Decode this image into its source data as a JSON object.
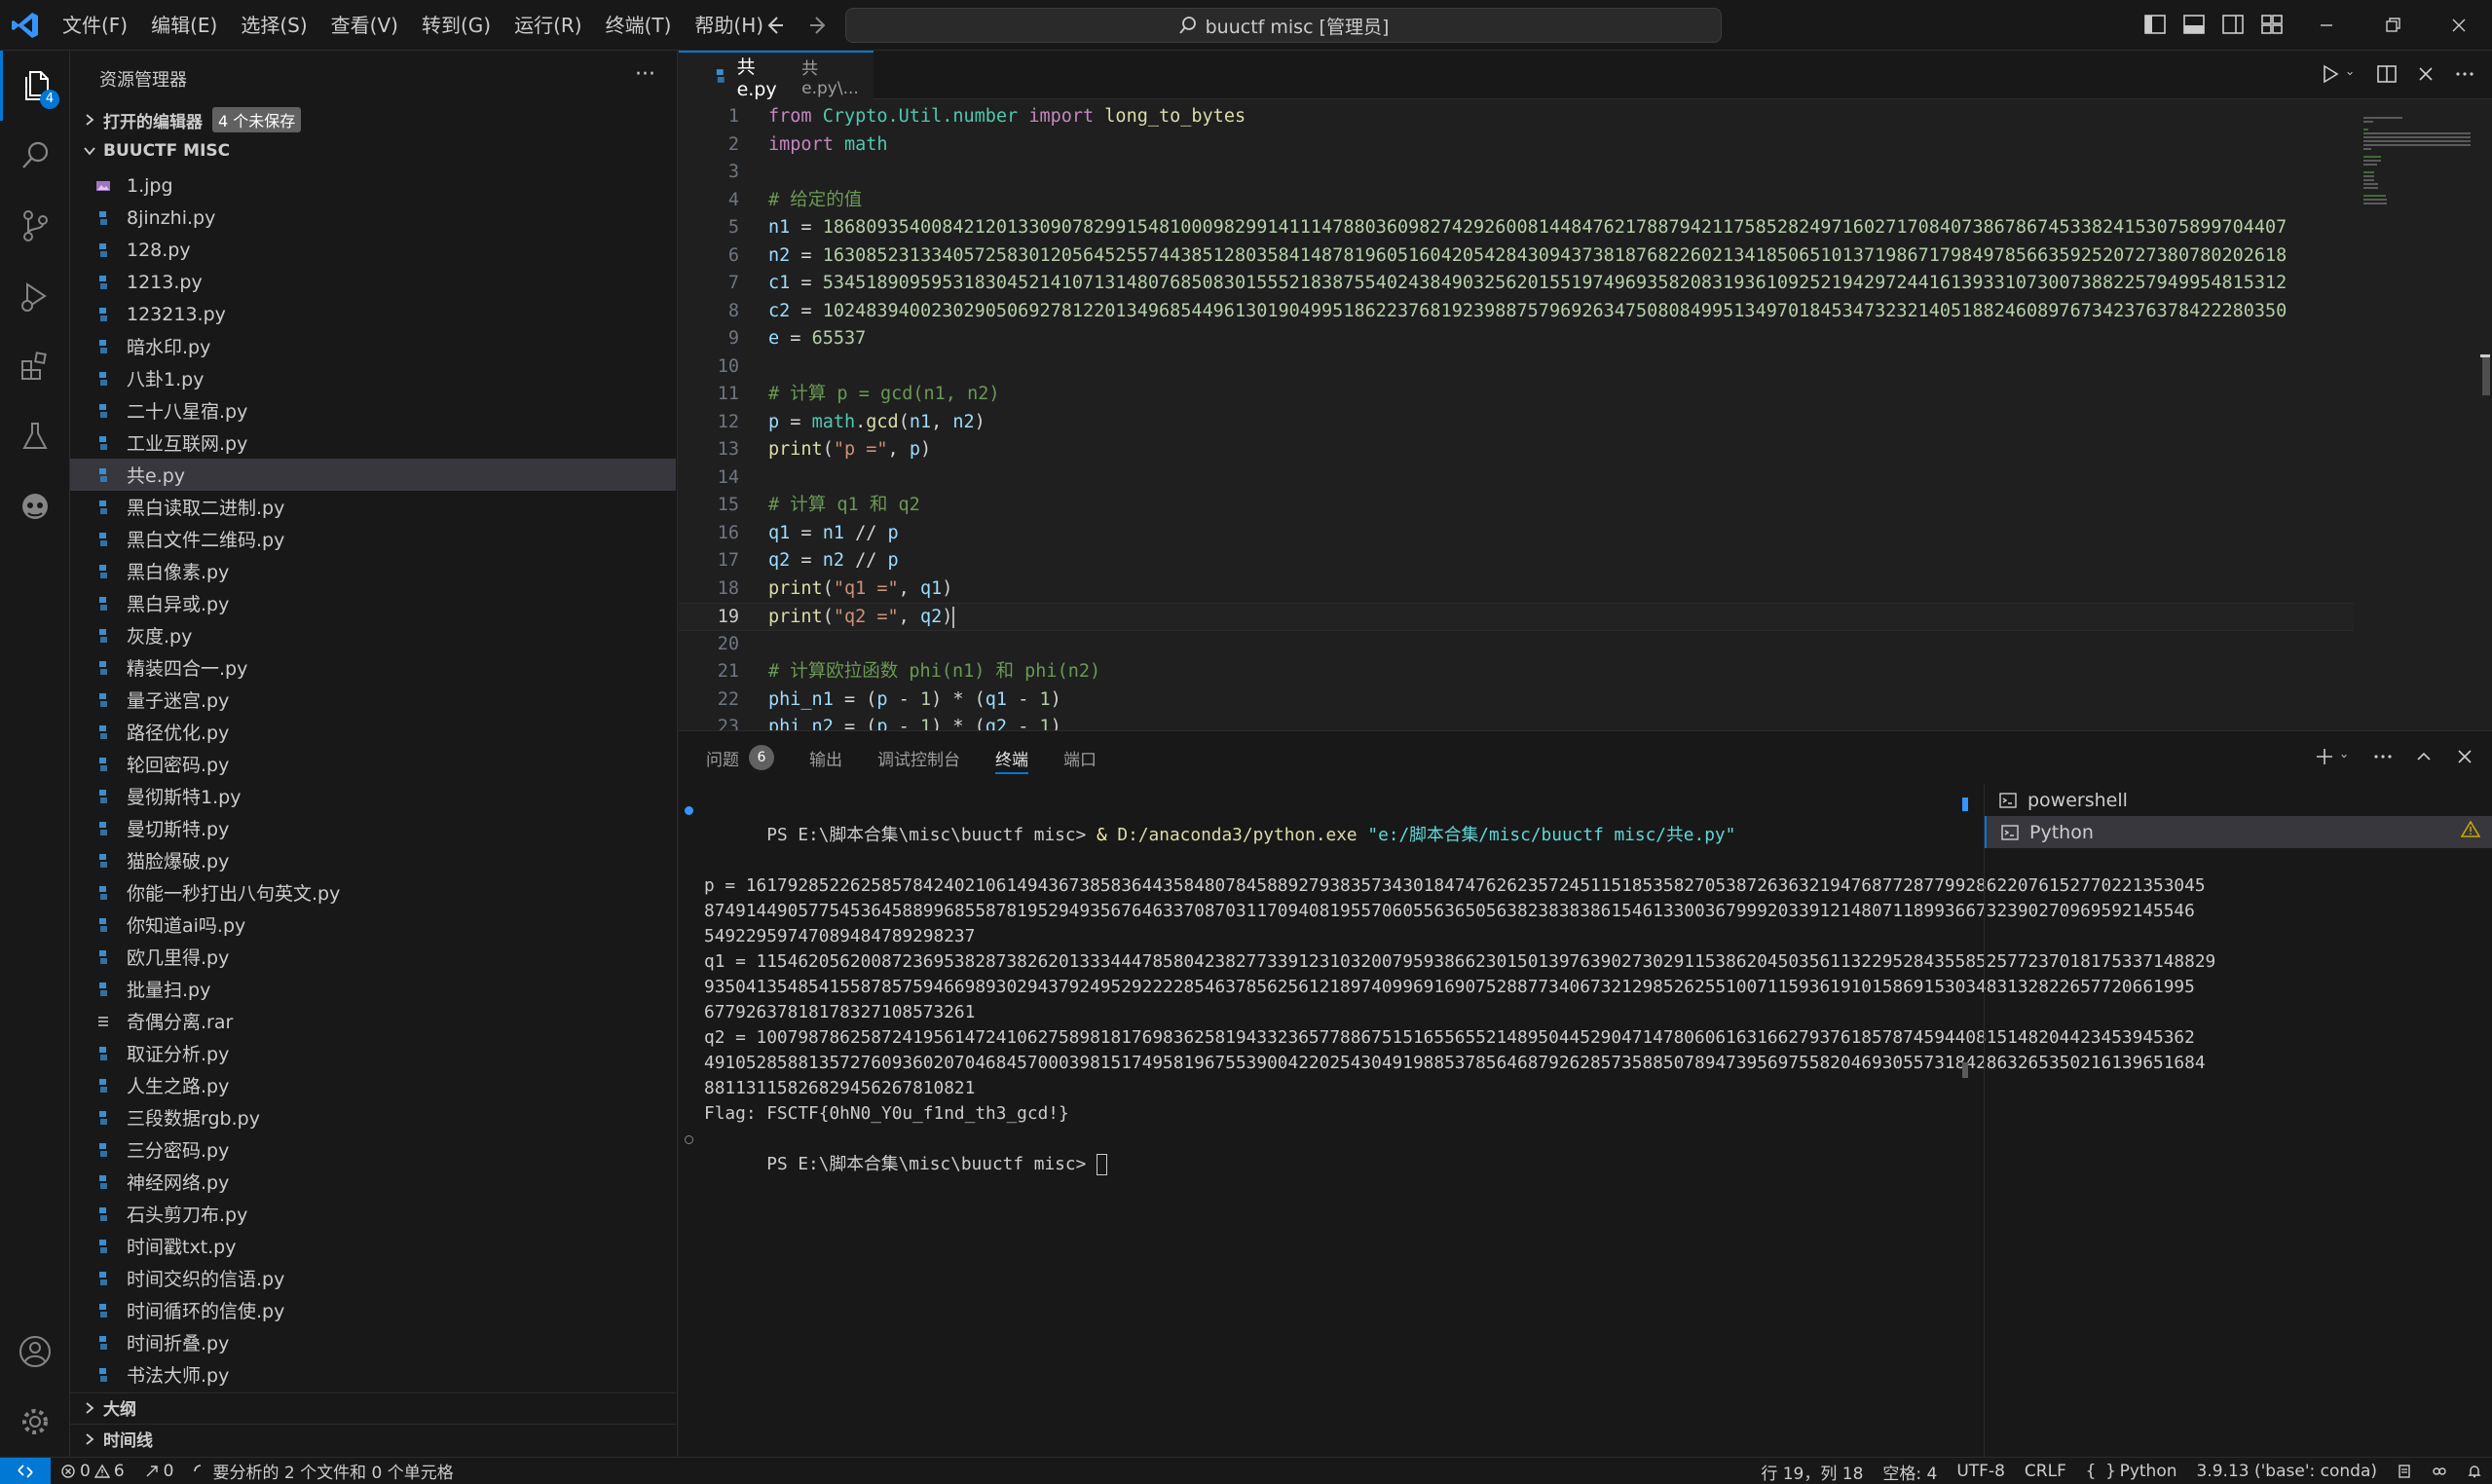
{
  "menu": [
    "文件(F)",
    "编辑(E)",
    "选择(S)",
    "查看(V)",
    "转到(G)",
    "运行(R)",
    "终端(T)",
    "帮助(H)"
  ],
  "search": {
    "text": "buuctf misc [管理员]"
  },
  "explorer": {
    "title": "资源管理器",
    "open_editors": "打开的编辑器",
    "unsaved_badge": "4 个未保存",
    "folder": "BUUCTF MISC",
    "files": [
      {
        "name": "1.jpg",
        "icon": "image-file-icon"
      },
      {
        "name": "8jinzhi.py",
        "icon": "python-file-icon"
      },
      {
        "name": "128.py",
        "icon": "python-file-icon"
      },
      {
        "name": "1213.py",
        "icon": "python-file-icon"
      },
      {
        "name": "123213.py",
        "icon": "python-file-icon"
      },
      {
        "name": "暗水印.py",
        "icon": "python-file-icon"
      },
      {
        "name": "八卦1.py",
        "icon": "python-file-icon"
      },
      {
        "name": "二十八星宿.py",
        "icon": "python-file-icon"
      },
      {
        "name": "工业互联网.py",
        "icon": "python-file-icon"
      },
      {
        "name": "共e.py",
        "icon": "python-file-icon",
        "active": true
      },
      {
        "name": "黑白读取二进制.py",
        "icon": "python-file-icon"
      },
      {
        "name": "黑白文件二维码.py",
        "icon": "python-file-icon"
      },
      {
        "name": "黑白像素.py",
        "icon": "python-file-icon"
      },
      {
        "name": "黑白异或.py",
        "icon": "python-file-icon"
      },
      {
        "name": "灰度.py",
        "icon": "python-file-icon"
      },
      {
        "name": "精装四合一.py",
        "icon": "python-file-icon"
      },
      {
        "name": "量子迷宫.py",
        "icon": "python-file-icon"
      },
      {
        "name": "路径优化.py",
        "icon": "python-file-icon"
      },
      {
        "name": "轮回密码.py",
        "icon": "python-file-icon"
      },
      {
        "name": "曼彻斯特1.py",
        "icon": "python-file-icon"
      },
      {
        "name": "曼切斯特.py",
        "icon": "python-file-icon"
      },
      {
        "name": "猫脸爆破.py",
        "icon": "python-file-icon"
      },
      {
        "name": "你能一秒打出八句英文.py",
        "icon": "python-file-icon"
      },
      {
        "name": "你知道ai吗.py",
        "icon": "python-file-icon"
      },
      {
        "name": "欧几里得.py",
        "icon": "python-file-icon"
      },
      {
        "name": "批量扫.py",
        "icon": "python-file-icon"
      },
      {
        "name": "奇偶分离.rar",
        "icon": "archive-file-icon"
      },
      {
        "name": "取证分析.py",
        "icon": "python-file-icon"
      },
      {
        "name": "人生之路.py",
        "icon": "python-file-icon"
      },
      {
        "name": "三段数据rgb.py",
        "icon": "python-file-icon"
      },
      {
        "name": "三分密码.py",
        "icon": "python-file-icon"
      },
      {
        "name": "神经网络.py",
        "icon": "python-file-icon"
      },
      {
        "name": "石头剪刀布.py",
        "icon": "python-file-icon"
      },
      {
        "name": "时间戳txt.py",
        "icon": "python-file-icon"
      },
      {
        "name": "时间交织的信语.py",
        "icon": "python-file-icon"
      },
      {
        "name": "时间循环的信使.py",
        "icon": "python-file-icon"
      },
      {
        "name": "时间折叠.py",
        "icon": "python-file-icon"
      },
      {
        "name": "书法大师.py",
        "icon": "python-file-icon"
      }
    ],
    "outline": "大纲",
    "timeline": "时间线"
  },
  "editor": {
    "tab_name": "共e.py",
    "tab_path": "共e.py\\...",
    "current_line": 19,
    "lines": [
      [
        [
          "kw",
          "from"
        ],
        [
          "op",
          " "
        ],
        [
          "nm",
          "Crypto.Util.number"
        ],
        [
          "op",
          " "
        ],
        [
          "kw",
          "import"
        ],
        [
          "op",
          " "
        ],
        [
          "fn",
          "long_to_bytes"
        ]
      ],
      [
        [
          "kw",
          "import"
        ],
        [
          "op",
          " "
        ],
        [
          "nm",
          "math"
        ]
      ],
      [],
      [
        [
          "cm",
          "# 给定的值"
        ]
      ],
      [
        [
          "va",
          "n1"
        ],
        [
          "op",
          " = "
        ],
        [
          "num",
          "186809354008421201330907829915481000982991411147880360982742926008144847621788794211758528249716027170840738678674533824153075899704407"
        ]
      ],
      [
        [
          "va",
          "n2"
        ],
        [
          "op",
          " = "
        ],
        [
          "num",
          "163085231334057258301205645255744385128035841487819605160420542843094373818768226021341850651013719867179849785663592520727380780202618"
        ]
      ],
      [
        [
          "va",
          "c1"
        ],
        [
          "op",
          " = "
        ],
        [
          "num",
          "534518909595318304521410713148076850830155521838755402438490325620155197496935820831936109252194297244161393310730073882257949954815312"
        ]
      ],
      [
        [
          "va",
          "c2"
        ],
        [
          "op",
          " = "
        ],
        [
          "num",
          "102483940023029050692781220134968544961301904995186223768192398875796926347508084995134970184534732321405188246089767342376378422280350"
        ]
      ],
      [
        [
          "va",
          "e"
        ],
        [
          "op",
          " = "
        ],
        [
          "num",
          "65537"
        ]
      ],
      [],
      [
        [
          "cm",
          "# 计算 p = gcd(n1, n2)"
        ]
      ],
      [
        [
          "va",
          "p"
        ],
        [
          "op",
          " = "
        ],
        [
          "nm",
          "math"
        ],
        [
          "op",
          "."
        ],
        [
          "fn",
          "gcd"
        ],
        [
          "op",
          "("
        ],
        [
          "va",
          "n1"
        ],
        [
          "op",
          ", "
        ],
        [
          "va",
          "n2"
        ],
        [
          "op",
          ")"
        ]
      ],
      [
        [
          "fn",
          "print"
        ],
        [
          "op",
          "("
        ],
        [
          "st",
          "\"p =\""
        ],
        [
          "op",
          ", "
        ],
        [
          "va",
          "p"
        ],
        [
          "op",
          ")"
        ]
      ],
      [],
      [
        [
          "cm",
          "# 计算 q1 和 q2"
        ]
      ],
      [
        [
          "va",
          "q1"
        ],
        [
          "op",
          " = "
        ],
        [
          "va",
          "n1"
        ],
        [
          "op",
          " // "
        ],
        [
          "va",
          "p"
        ]
      ],
      [
        [
          "va",
          "q2"
        ],
        [
          "op",
          " = "
        ],
        [
          "va",
          "n2"
        ],
        [
          "op",
          " // "
        ],
        [
          "va",
          "p"
        ]
      ],
      [
        [
          "fn",
          "print"
        ],
        [
          "op",
          "("
        ],
        [
          "st",
          "\"q1 =\""
        ],
        [
          "op",
          ", "
        ],
        [
          "va",
          "q1"
        ],
        [
          "op",
          ")"
        ]
      ],
      [
        [
          "fn",
          "print"
        ],
        [
          "op",
          "("
        ],
        [
          "st",
          "\"q2 =\""
        ],
        [
          "op",
          ", "
        ],
        [
          "va",
          "q2"
        ],
        [
          "op",
          ")"
        ]
      ],
      [],
      [
        [
          "cm",
          "# 计算欧拉函数 phi(n1) 和 phi(n2)"
        ]
      ],
      [
        [
          "va",
          "phi_n1"
        ],
        [
          "op",
          " = ("
        ],
        [
          "va",
          "p"
        ],
        [
          "op",
          " - "
        ],
        [
          "num",
          "1"
        ],
        [
          "op",
          ") * ("
        ],
        [
          "va",
          "q1"
        ],
        [
          "op",
          " - "
        ],
        [
          "num",
          "1"
        ],
        [
          "op",
          ")"
        ]
      ],
      [
        [
          "va",
          "phi_n2"
        ],
        [
          "op",
          " = ("
        ],
        [
          "va",
          "p"
        ],
        [
          "op",
          " - "
        ],
        [
          "num",
          "1"
        ],
        [
          "op",
          ") * ("
        ],
        [
          "va",
          "q2"
        ],
        [
          "op",
          " - "
        ],
        [
          "num",
          "1"
        ],
        [
          "op",
          ")"
        ]
      ]
    ]
  },
  "panel": {
    "tabs": [
      {
        "label": "问题",
        "badge": "6"
      },
      {
        "label": "输出"
      },
      {
        "label": "调试控制台"
      },
      {
        "label": "终端",
        "active": true
      },
      {
        "label": "端口"
      }
    ],
    "terminal": {
      "prompt1": "PS E:\\脚本合集\\misc\\buuctf misc> ",
      "cmd_amp": "& ",
      "cmd_exe": "D:/anaconda3/python.exe",
      "cmd_arg": " \"e:/脚本合集/misc/buuctf misc/共e.py\"",
      "output": [
        "p = 16179285226258578424021061494367385836443584807845889279383573430184747626235724511518535827053872636321947687728779928622076152770221353045",
        "87491449057754536458899685587819529493567646337087031170940819557060556365056382383838615461330036799920339121480711899366732390270969592145546",
        "5492295974708948478929823​7",
        "q1 = 11546205620087236953828738262013334447858042382773391231032007959386623015013976390273029115386204503561132295284355852577237018175337148829",
        "93504135485415587857594669893029437924952922228546378562561218974099691690752887734067321298526255100711593619101586915303483132822657720661995",
        "6779263781817832710857326​1",
        "q2 = 10079878625872419561472410627589818176983625819433236577886751516556552148950445290471478060616316627937618578745944081514820442345394536​2",
        "49105285881357276093602070468457000398151749581967553900422025430491988537856468792628573588507894739569755820469305573184286326535021613965168​4",
        "8811311582682945626781082​1",
        "Flag: FSCTF{0hN0_Y0u_f1nd_th3_gcd!}"
      ],
      "prompt2": "PS E:\\脚本合集\\misc\\buuctf misc> "
    },
    "terminal_list": [
      {
        "name": "powershell",
        "icon": "terminal-icon"
      },
      {
        "name": "Python",
        "icon": "terminal-icon",
        "active": true
      }
    ]
  },
  "status": {
    "errors": "0",
    "warnings": "6",
    "ports": "0",
    "analysis": "要分析的 2 个文件和 0 个单元格",
    "position": "行 19，列 18",
    "spaces": "空格: 4",
    "encoding": "UTF-8",
    "eol": "CRLF",
    "language": "Python",
    "interpreter": "3.9.13 ('base': conda)"
  },
  "colors": {
    "accent": "#0078d4",
    "background": "#1f1f1f",
    "sidebar": "#181818"
  }
}
